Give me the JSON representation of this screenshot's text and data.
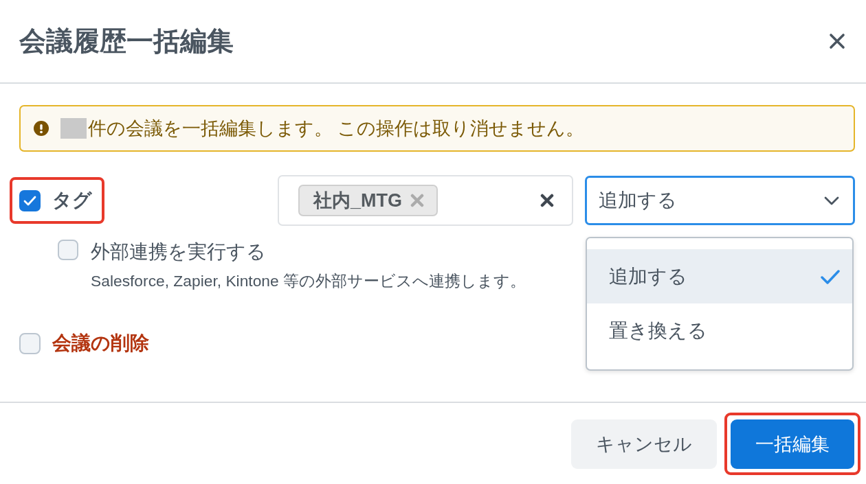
{
  "dialog": {
    "title": "会議履歴一括編集"
  },
  "alert": {
    "redacted": true,
    "text": "件の会議を一括編集します。 この操作は取り消せません。"
  },
  "options": [
    {
      "kind": "tag",
      "label": "タグ",
      "checked": true,
      "highlighted": true,
      "tags": [
        {
          "label": "社内_MTG"
        }
      ],
      "mode": {
        "value": "追加する",
        "open": true,
        "options": [
          {
            "label": "追加する",
            "selected": true
          },
          {
            "label": "置き換える",
            "selected": false
          }
        ]
      },
      "sub_option": {
        "label": "外部連携を実行する",
        "checked": false,
        "description": "Salesforce, Zapier, Kintone 等の外部サービスへ連携します。"
      }
    },
    {
      "kind": "delete",
      "label": "会議の削除",
      "checked": false,
      "highlighted": false
    }
  ],
  "buttons": [
    {
      "kind": "secondary",
      "label": "キャンセル",
      "highlighted": false
    },
    {
      "kind": "primary",
      "label": "一括編集",
      "highlighted": true
    }
  ]
}
